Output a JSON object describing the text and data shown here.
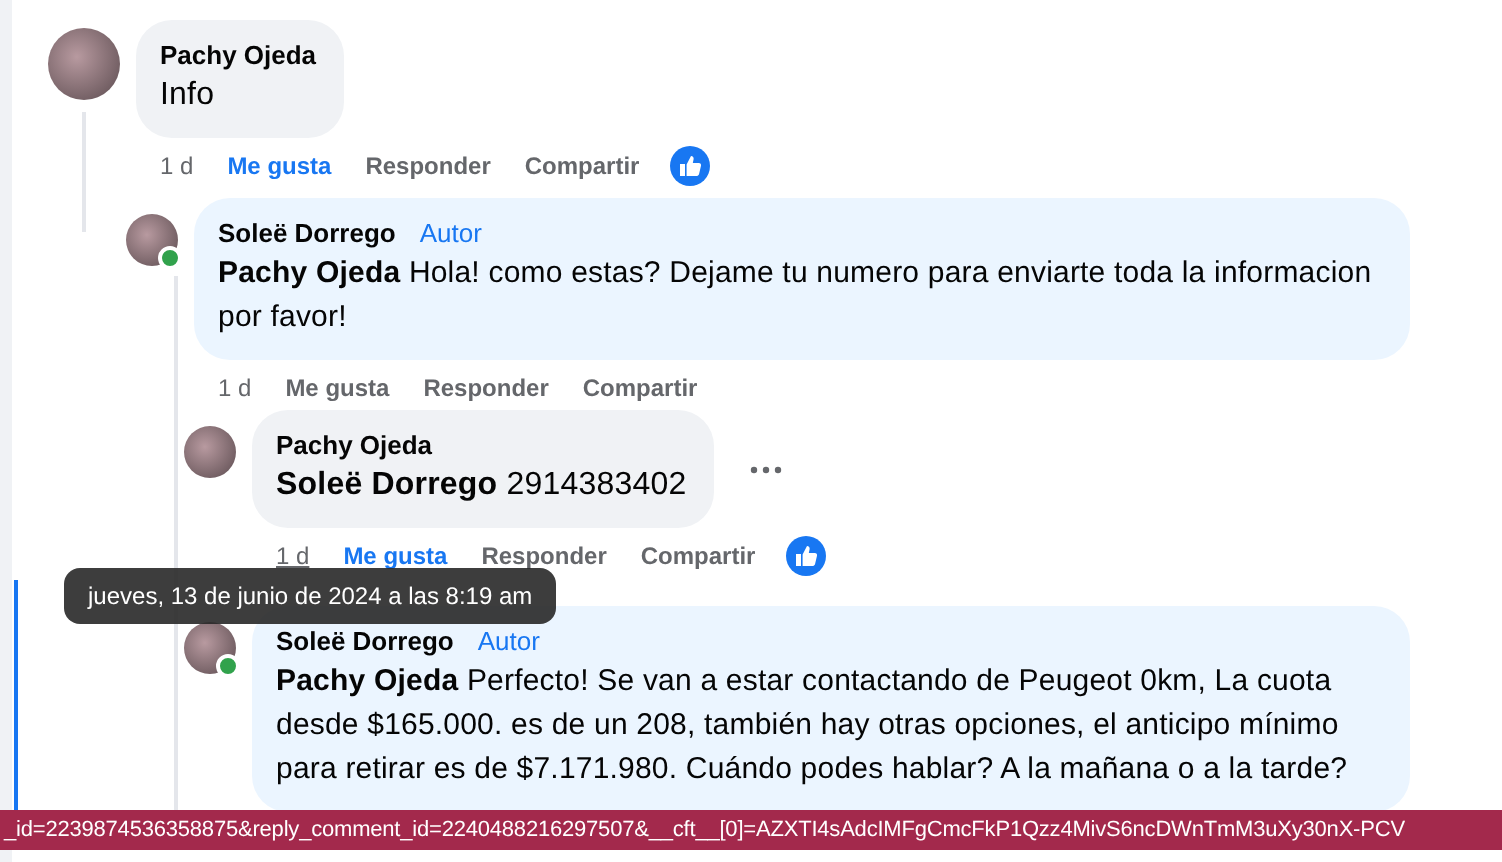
{
  "comments": [
    {
      "author": "Pachy Ojeda",
      "text": "Info",
      "time": "1 d",
      "liked": true,
      "reaction": true,
      "actions": [
        "Me gusta",
        "Responder",
        "Compartir"
      ],
      "replies": [
        {
          "author": "Soleë Dorrego",
          "badge": "Autor",
          "mention": "Pachy Ojeda",
          "text": "Hola! como estas? Dejame tu numero para enviarte toda la informacion por favor!",
          "time": "1 d",
          "liked": false,
          "online": true,
          "actions": [
            "Me gusta",
            "Responder",
            "Compartir"
          ],
          "replies": [
            {
              "author": "Pachy Ojeda",
              "mention": "Soleë Dorrego",
              "text": "2914383402",
              "time": "1 d",
              "time_hovered": true,
              "liked": true,
              "reaction": true,
              "more_menu": true,
              "actions": [
                "Me gusta",
                "Responder",
                "Compartir"
              ]
            },
            {
              "author": "Soleë Dorrego",
              "badge": "Autor",
              "mention": "Pachy Ojeda",
              "text": "Perfecto! Se van a estar contactando de Peugeot 0km, La cuota desde $165.000. es de un 208, también hay otras opciones, el anticipo mínimo para retirar es de $7.171.980. Cuándo podes hablar? A la mañana o a la tarde?",
              "online": true
            }
          ]
        }
      ]
    }
  ],
  "tooltip": "jueves, 13 de junio de 2024 a las 8:19 am",
  "status_bar": "_id=2239874536358875&reply_comment_id=2240488216297507&__cft__[0]=AZXTI4sAdcIMFgCmcFkP1Qzz4MivS6ncDWnTmM3uXy30nX-PCV"
}
